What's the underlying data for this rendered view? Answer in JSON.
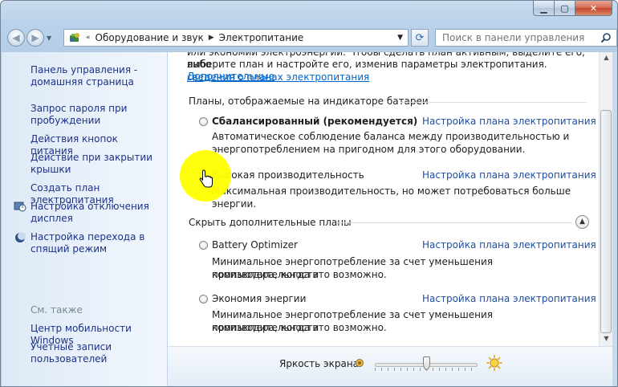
{
  "window": {
    "title": ""
  },
  "nav": {
    "back_icon": "back-arrow-icon",
    "forward_icon": "forward-arrow-icon",
    "breadcrumb": [
      "Оборудование и звук",
      "Электропитание"
    ],
    "search_placeholder": "Поиск в панели управления"
  },
  "sidebar": {
    "home": "Панель управления - домашняя страница",
    "items": [
      "Запрос пароля при пробуждении",
      "Действия кнопок питания",
      "Действие при закрытии крышки",
      "Создать план электропитания",
      "Настройка отключения дисплея",
      "Настройка перехода в спящий режим"
    ],
    "see_also": "См. также",
    "see_also_items": [
      "Центр мобильности Windows",
      "Учетные записи пользователей"
    ]
  },
  "main": {
    "intro_line1": "или экономии электроэнергии. Чтобы сделать план активным, выделите его, либо",
    "intro_line2": "выберите план и настройте его, изменив параметры электропитания.",
    "intro_link_a": "Дополнительные",
    "intro_link_b": "сведения о планах электропитания",
    "section_battery": "Планы, отображаемые на индикаторе батареи",
    "section_hidden": "Скрыть дополнительные планы",
    "plans": [
      {
        "name": "Сбалансированный (рекомендуется)",
        "selected": false,
        "bold": true,
        "link": "Настройка плана электропитания",
        "desc1": "Автоматическое соблюдение баланса между производительностью и",
        "desc2": "энергопотреблением на пригодном для этого оборудовании."
      },
      {
        "name": "Высокая производительность",
        "selected": true,
        "bold": false,
        "link": "Настройка плана электропитания",
        "desc1": "Максимальная производительность, но может потребоваться больше энергии.",
        "desc2": ""
      },
      {
        "name": "Battery Optimizer",
        "selected": false,
        "bold": false,
        "link": "Настройка плана электропитания",
        "desc1": "Минимальное энергопотребление за счет уменьшения производительности",
        "desc2": "компьютера, когда это возможно."
      },
      {
        "name": "Экономия энергии",
        "selected": false,
        "bold": false,
        "link": "Настройка плана электропитания",
        "desc1": "Минимальное энергопотребление за счет уменьшения производительности",
        "desc2": "компьютера, когда это возможно."
      }
    ]
  },
  "footer": {
    "brightness_label": "Яркость экрана:",
    "brightness_level": 0.5
  },
  "colors": {
    "link": "#1f4ea3",
    "sidebar_link": "#1e3287",
    "cursor_highlight": "#ffff00"
  }
}
